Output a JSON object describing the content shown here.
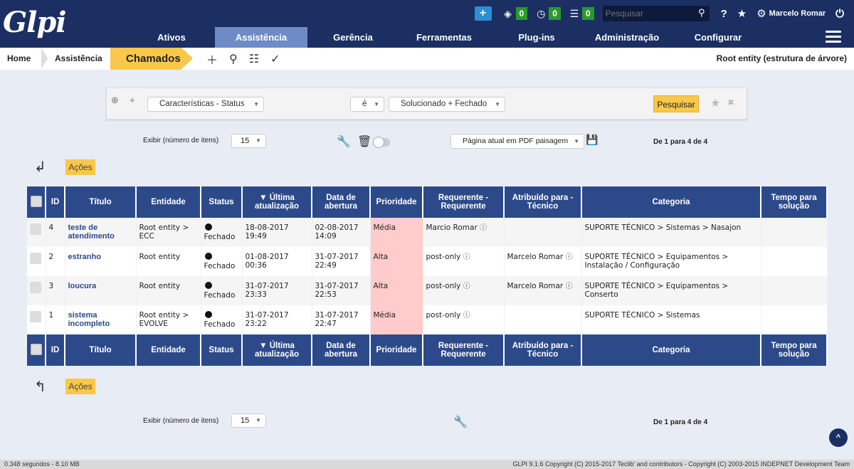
{
  "app": {
    "logo_text": "Glpi"
  },
  "topbar": {
    "counts": {
      "tickets": "0",
      "timer": "0",
      "reminders": "0"
    },
    "search_placeholder": "Pesquisar",
    "user": "Marcelo Romar"
  },
  "nav": {
    "items": [
      "Ativos",
      "Assistência",
      "Gerência",
      "Ferramentas",
      "Plug-ins",
      "Administração",
      "Configurar"
    ],
    "active": "Assistência"
  },
  "breadcrumb": {
    "home": "Home",
    "section": "Assistência",
    "current": "Chamados",
    "entity": "Root entity (estrutura de árvore)"
  },
  "criteria": {
    "field": "Características - Status",
    "operator": "é",
    "value": "Solucionado + Fechado",
    "search_button": "Pesquisar"
  },
  "pager": {
    "label": "Exibir (número de itens)",
    "per_page": "15",
    "export": "Página atual em PDF paisagem",
    "count": "De 1 para 4 de 4"
  },
  "actions_label": "Ações",
  "table": {
    "columns": [
      "ID",
      "Título",
      "Entidade",
      "Status",
      "▼ Última atualização",
      "Data de abertura",
      "Prioridade",
      "Requerente - Requerente",
      "Atribuído para - Técnico",
      "Categoria",
      "Tempo para solução"
    ],
    "rows": [
      {
        "id": "4",
        "title": "teste de atendimento",
        "entity": "Root entity > ECC",
        "status": "Fechado",
        "updated": "18-08-2017 19:49",
        "opened": "02-08-2017 14:09",
        "priority": "Média",
        "requester": "Marcio Romar",
        "assigned": "",
        "category": "SUPORTE TÉCNICO > Sistemas > Nasajon",
        "ttr": ""
      },
      {
        "id": "2",
        "title": "estranho",
        "entity": "Root entity",
        "status": "Fechado",
        "updated": "01-08-2017 00:36",
        "opened": "31-07-2017 22:49",
        "priority": "Alta",
        "requester": "post-only",
        "assigned": "Marcelo Romar",
        "category": "SUPORTE TÉCNICO > Equipamentos > Instalação / Configuração",
        "ttr": ""
      },
      {
        "id": "3",
        "title": "loucura",
        "entity": "Root entity",
        "status": "Fechado",
        "updated": "31-07-2017 23:33",
        "opened": "31-07-2017 22:53",
        "priority": "Alta",
        "requester": "post-only",
        "assigned": "Marcelo Romar",
        "category": "SUPORTE TÉCNICO > Equipamentos > Conserto",
        "ttr": ""
      },
      {
        "id": "1",
        "title": "sistema incompleto",
        "entity": "Root entity > EVOLVE",
        "status": "Fechado",
        "updated": "31-07-2017 23:22",
        "opened": "31-07-2017 22:47",
        "priority": "Média",
        "requester": "post-only",
        "assigned": "",
        "category": "SUPORTE TÉCNICO > Sistemas",
        "ttr": ""
      }
    ]
  },
  "footer": {
    "left": "0.348 segundos - 8.10 MB",
    "right": "GLPI 9.1.6 Copyright (C) 2015-2017 Teclib' and contributors - Copyright (C) 2003-2015 INDEPNET Development Team"
  }
}
